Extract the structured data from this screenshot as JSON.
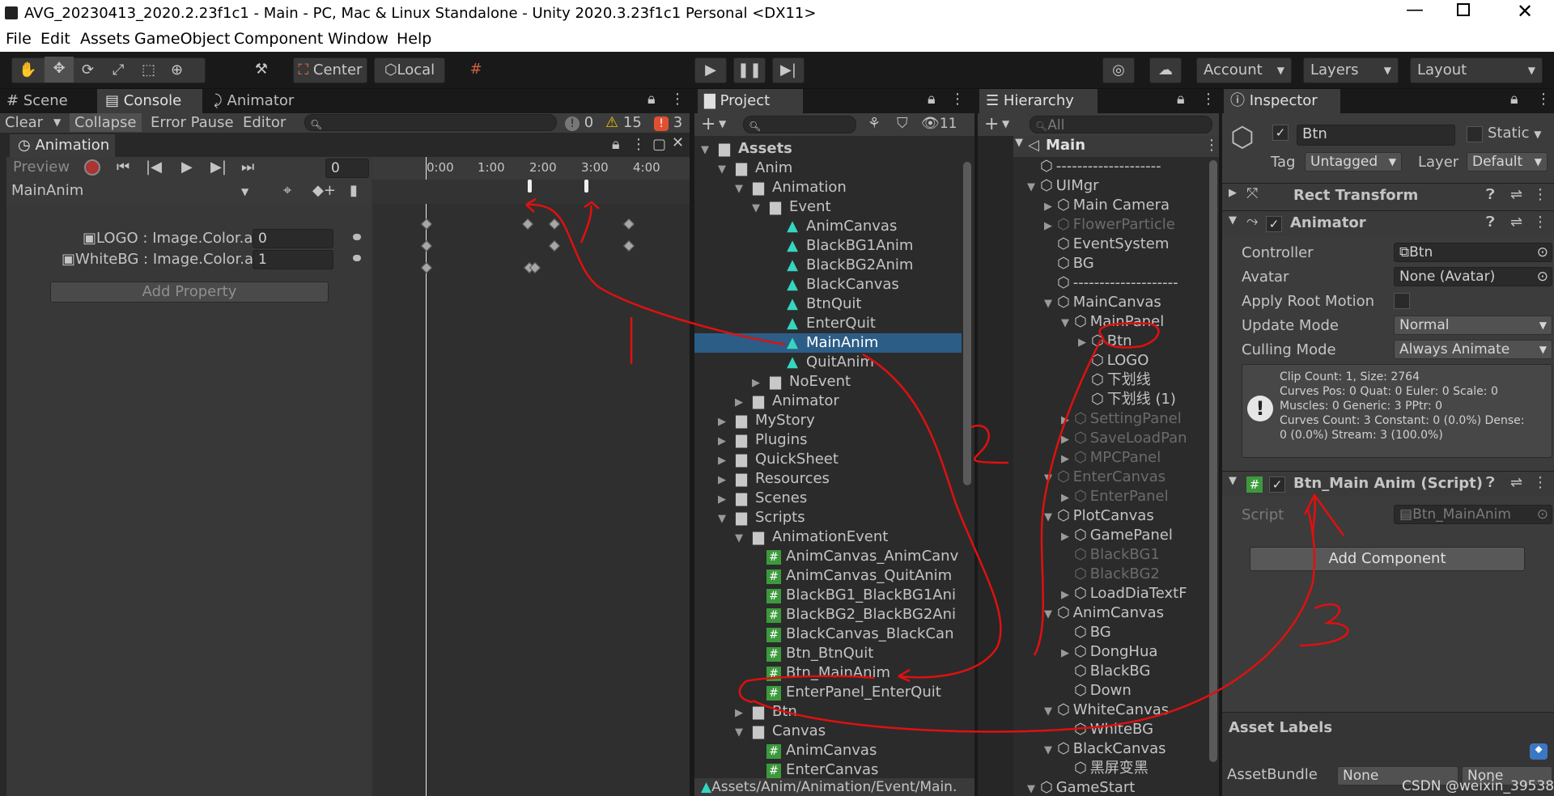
{
  "window": {
    "title": "AVG_20230413_2020.2.23f1c1 - Main - PC, Mac & Linux Standalone - Unity 2020.3.23f1c1 Personal <DX11>"
  },
  "menu": [
    "File",
    "Edit",
    "Assets",
    "GameObject",
    "Component",
    "Window",
    "Help"
  ],
  "toolbar": {
    "center": "Center",
    "local": "Local",
    "account": "Account",
    "layers": "Layers",
    "layout": "Layout"
  },
  "left_tabs": {
    "scene": "Scene",
    "console": "Console",
    "animator": "Animator"
  },
  "console": {
    "clear": "Clear",
    "collapse": "Collapse",
    "error_pause": "Error Pause",
    "editor": "Editor",
    "info": "0",
    "warn": "15",
    "err": "3"
  },
  "animation": {
    "title": "Animation",
    "preview": "Preview",
    "frame": "0",
    "clip": "MainAnim",
    "props": [
      {
        "name": "LOGO : Image.Color.a",
        "value": "0"
      },
      {
        "name": "WhiteBG : Image.Color.a",
        "value": "1"
      }
    ],
    "add_property": "Add Property",
    "ticks": [
      "0:00",
      "1:00",
      "2:00",
      "3:00",
      "4:00"
    ]
  },
  "project": {
    "title": "Project",
    "path": "Assets/Anim/Animation/Event/Main.",
    "items": [
      {
        "t": "Assets",
        "d": 0,
        "ic": "folder",
        "a": "open",
        "bold": true
      },
      {
        "t": "Anim",
        "d": 1,
        "ic": "folder",
        "a": "open"
      },
      {
        "t": "Animation",
        "d": 2,
        "ic": "folder",
        "a": "open"
      },
      {
        "t": "Event",
        "d": 3,
        "ic": "folder",
        "a": "open"
      },
      {
        "t": "AnimCanvas",
        "d": 4,
        "ic": "anim",
        "a": ""
      },
      {
        "t": "BlackBG1Anim",
        "d": 4,
        "ic": "anim",
        "a": ""
      },
      {
        "t": "BlackBG2Anim",
        "d": 4,
        "ic": "anim",
        "a": ""
      },
      {
        "t": "BlackCanvas",
        "d": 4,
        "ic": "anim",
        "a": ""
      },
      {
        "t": "BtnQuit",
        "d": 4,
        "ic": "anim",
        "a": ""
      },
      {
        "t": "EnterQuit",
        "d": 4,
        "ic": "anim",
        "a": ""
      },
      {
        "t": "MainAnim",
        "d": 4,
        "ic": "anim",
        "a": "",
        "sel": true
      },
      {
        "t": "QuitAnim",
        "d": 4,
        "ic": "anim",
        "a": ""
      },
      {
        "t": "NoEvent",
        "d": 3,
        "ic": "folder",
        "a": "closed"
      },
      {
        "t": "Animator",
        "d": 2,
        "ic": "folder",
        "a": "closed"
      },
      {
        "t": "MyStory",
        "d": 1,
        "ic": "folder",
        "a": "closed"
      },
      {
        "t": "Plugins",
        "d": 1,
        "ic": "folder",
        "a": "closed"
      },
      {
        "t": "QuickSheet",
        "d": 1,
        "ic": "folder",
        "a": "closed"
      },
      {
        "t": "Resources",
        "d": 1,
        "ic": "folder",
        "a": "closed"
      },
      {
        "t": "Scenes",
        "d": 1,
        "ic": "folder",
        "a": "closed"
      },
      {
        "t": "Scripts",
        "d": 1,
        "ic": "folder",
        "a": "open"
      },
      {
        "t": "AnimationEvent",
        "d": 2,
        "ic": "folder",
        "a": "open"
      },
      {
        "t": "AnimCanvas_AnimCanv",
        "d": 3,
        "ic": "script",
        "a": ""
      },
      {
        "t": "AnimCanvas_QuitAnim",
        "d": 3,
        "ic": "script",
        "a": ""
      },
      {
        "t": "BlackBG1_BlackBG1Ani",
        "d": 3,
        "ic": "script",
        "a": ""
      },
      {
        "t": "BlackBG2_BlackBG2Ani",
        "d": 3,
        "ic": "script",
        "a": ""
      },
      {
        "t": "BlackCanvas_BlackCan",
        "d": 3,
        "ic": "script",
        "a": ""
      },
      {
        "t": "Btn_BtnQuit",
        "d": 3,
        "ic": "script",
        "a": ""
      },
      {
        "t": "Btn_MainAnim",
        "d": 3,
        "ic": "script",
        "a": ""
      },
      {
        "t": "EnterPanel_EnterQuit",
        "d": 3,
        "ic": "script",
        "a": ""
      },
      {
        "t": "Btn",
        "d": 2,
        "ic": "folder",
        "a": "closed"
      },
      {
        "t": "Canvas",
        "d": 2,
        "ic": "folder",
        "a": "open"
      },
      {
        "t": "AnimCanvas",
        "d": 3,
        "ic": "script",
        "a": ""
      },
      {
        "t": "EnterCanvas",
        "d": 3,
        "ic": "script",
        "a": ""
      }
    ]
  },
  "hierarchy": {
    "title": "Hierarchy",
    "search": "All",
    "scene": "Main",
    "items": [
      {
        "t": "--------------------",
        "d": 1,
        "a": ""
      },
      {
        "t": "UIMgr",
        "d": 1,
        "a": "open"
      },
      {
        "t": "Main Camera",
        "d": 2,
        "a": "closed"
      },
      {
        "t": "FlowerParticle",
        "d": 2,
        "a": "closed",
        "dim": true
      },
      {
        "t": "EventSystem",
        "d": 2,
        "a": ""
      },
      {
        "t": "BG",
        "d": 2,
        "a": ""
      },
      {
        "t": "--------------------",
        "d": 2,
        "a": ""
      },
      {
        "t": "MainCanvas",
        "d": 2,
        "a": "open"
      },
      {
        "t": "MainPanel",
        "d": 3,
        "a": "open"
      },
      {
        "t": "Btn",
        "d": 4,
        "a": "closed"
      },
      {
        "t": "LOGO",
        "d": 4,
        "a": ""
      },
      {
        "t": "下划线",
        "d": 4,
        "a": ""
      },
      {
        "t": "下划线 (1)",
        "d": 4,
        "a": ""
      },
      {
        "t": "SettingPanel",
        "d": 3,
        "a": "closed",
        "dim": true
      },
      {
        "t": "SaveLoadPan",
        "d": 3,
        "a": "closed",
        "dim": true
      },
      {
        "t": "MPCPanel",
        "d": 3,
        "a": "closed",
        "dim": true
      },
      {
        "t": "EnterCanvas",
        "d": 2,
        "a": "open",
        "dim": true
      },
      {
        "t": "EnterPanel",
        "d": 3,
        "a": "closed",
        "dim": true
      },
      {
        "t": "PlotCanvas",
        "d": 2,
        "a": "open"
      },
      {
        "t": "GamePanel",
        "d": 3,
        "a": "closed"
      },
      {
        "t": "BlackBG1",
        "d": 3,
        "a": "",
        "dim": true
      },
      {
        "t": "BlackBG2",
        "d": 3,
        "a": "",
        "dim": true
      },
      {
        "t": "LoadDiaTextF",
        "d": 3,
        "a": "closed"
      },
      {
        "t": "AnimCanvas",
        "d": 2,
        "a": "open"
      },
      {
        "t": "BG",
        "d": 3,
        "a": ""
      },
      {
        "t": "DongHua",
        "d": 3,
        "a": "closed"
      },
      {
        "t": "BlackBG",
        "d": 3,
        "a": ""
      },
      {
        "t": "Down",
        "d": 3,
        "a": ""
      },
      {
        "t": "WhiteCanvas",
        "d": 2,
        "a": "open"
      },
      {
        "t": "WhiteBG",
        "d": 3,
        "a": ""
      },
      {
        "t": "BlackCanvas",
        "d": 2,
        "a": "open"
      },
      {
        "t": "黑屏变黑",
        "d": 3,
        "a": ""
      },
      {
        "t": "GameStart",
        "d": 1,
        "a": "open"
      }
    ]
  },
  "inspector": {
    "title": "Inspector",
    "name": "Btn",
    "static": "Static",
    "tag_label": "Tag",
    "tag": "Untagged",
    "layer_label": "Layer",
    "layer": "Default",
    "rect": "Rect Transform",
    "animator": "Animator",
    "fields": [
      {
        "label": "Controller",
        "value": "Btn"
      },
      {
        "label": "Avatar",
        "value": "None (Avatar)"
      },
      {
        "label": "Apply Root Motion",
        "value": ""
      },
      {
        "label": "Update Mode",
        "value": "Normal"
      },
      {
        "label": "Culling Mode",
        "value": "Always Animate"
      }
    ],
    "info": [
      "Clip Count: 1, Size: 2764",
      "Curves Pos: 0 Quat: 0 Euler: 0 Scale: 0",
      "Muscles: 0 Generic: 3 PPtr: 0",
      "Curves Count: 3 Constant: 0 (0.0%) Dense:",
      "0 (0.0%) Stream: 3 (100.0%)"
    ],
    "script_comp": "Btn_Main Anim (Script)",
    "script_label": "Script",
    "script_value": "Btn_MainAnim",
    "add_component": "Add Component",
    "asset_labels": "Asset Labels",
    "asset_bundle": "AssetBundle",
    "asset_bundle_value": "None",
    "asset_bundle_value2": "None"
  },
  "annotations": {
    "n1": "1",
    "n2": "2",
    "n3": "3"
  },
  "watermark": "CSDN @weixin_39538253",
  "colors": {
    "selection": "#2c5d87",
    "annotation": "#e01010",
    "anim_icon": "#35d6c0",
    "script_icon": "#3c9a3c"
  }
}
